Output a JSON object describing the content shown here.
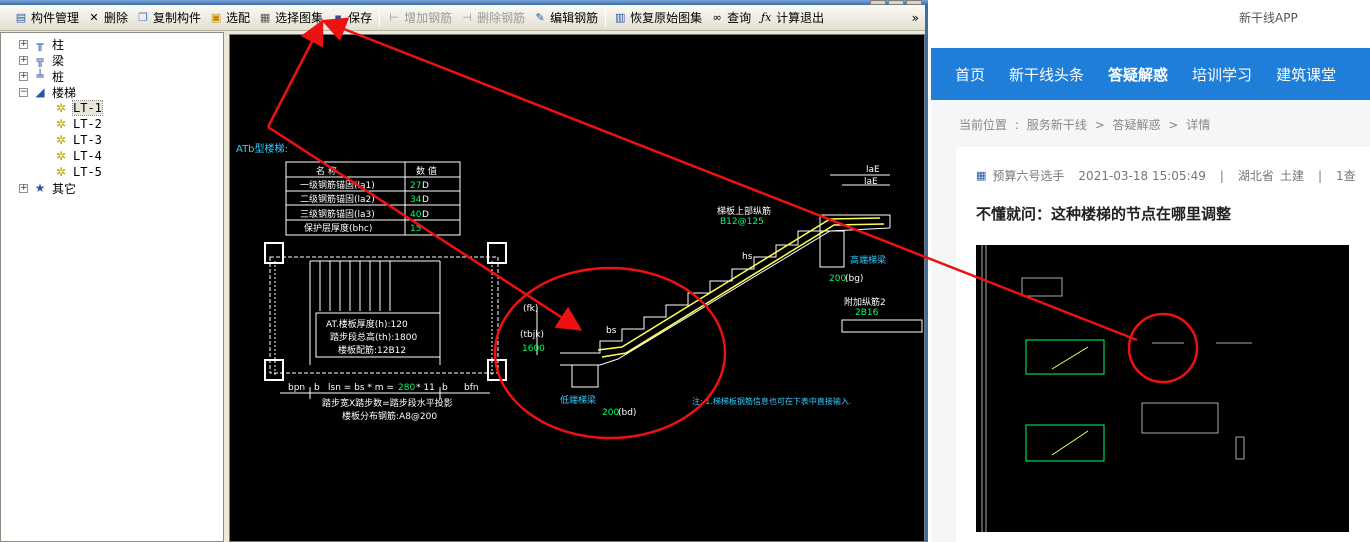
{
  "toolbar": {
    "items": [
      {
        "label": "构件管理",
        "icon": "list-icon",
        "enabled": true
      },
      {
        "label": "删除",
        "icon": "close-icon",
        "enabled": true
      },
      {
        "label": "复制构件",
        "icon": "copy-icon",
        "enabled": true
      },
      {
        "label": "选配",
        "icon": "select-icon",
        "enabled": true
      },
      {
        "label": "选择图集",
        "icon": "atlas-icon",
        "enabled": true
      },
      {
        "label": "保存",
        "icon": "save-icon",
        "enabled": true
      },
      {
        "label": "增加钢筋",
        "icon": "add-rebar-icon",
        "enabled": false
      },
      {
        "label": "删除钢筋",
        "icon": "delete-rebar-icon",
        "enabled": false
      },
      {
        "label": "编辑钢筋",
        "icon": "edit-rebar-icon",
        "enabled": true
      },
      {
        "label": "恢复原始图集",
        "icon": "restore-icon",
        "enabled": true
      },
      {
        "label": "查询",
        "icon": "binoculars-icon",
        "enabled": true
      },
      {
        "label": "计算退出",
        "icon": "fx-icon",
        "enabled": true
      }
    ],
    "overflow": "»"
  },
  "tree": {
    "items": [
      {
        "label": "柱",
        "expander": "+"
      },
      {
        "label": "梁",
        "expander": "+"
      },
      {
        "label": "桩",
        "expander": "+"
      },
      {
        "label": "楼梯",
        "expander": "−"
      },
      {
        "label": "LT-1"
      },
      {
        "label": "LT-2"
      },
      {
        "label": "LT-3"
      },
      {
        "label": "LT-4"
      },
      {
        "label": "LT-5"
      },
      {
        "label": "其它",
        "expander": "+"
      }
    ]
  },
  "drawing": {
    "title": "ATb型楼梯:",
    "table_headers": [
      "名  称",
      "数  值"
    ],
    "table_rows": [
      {
        "name": "一级钢筋锚固(la1)",
        "value": "27",
        "unit": "D"
      },
      {
        "name": "二级钢筋锚固(la2)",
        "value": "34",
        "unit": "D"
      },
      {
        "name": "三级钢筋锚固(la3)",
        "value": "40",
        "unit": "D"
      },
      {
        "name": "保护层厚度(bhc)",
        "value": "15",
        "unit": ""
      }
    ],
    "plan_notes": [
      "AT.楼板厚度(h):120",
      "踏步段总高(th):1800",
      "楼板配筋:12B12"
    ],
    "plan_dims": [
      "bpn",
      "b",
      "lsn = bs * m =",
      "280",
      "* 11",
      "b",
      "bfn"
    ],
    "plan_captions": [
      "踏步宽X踏步数=踏步段水平投影",
      "楼板分布钢筋:A8@200"
    ],
    "elev_labels": {
      "upper_rebar": "梯板上部纵筋",
      "upper_rebar_val": "B12@125",
      "high_beam": "高端梯梁",
      "low_beam": "低端梯梁",
      "extra_rebar": "附加纵筋2",
      "extra_rebar_val": "2B16",
      "bs": "bs",
      "hs": "hs",
      "fk": "(fk)",
      "tbjk": "(tbjk)",
      "tbjk_val": "1600",
      "bd": "(bd)",
      "bd_val": "200",
      "bg": "(bg)",
      "bg_val": "200",
      "la": "laE",
      "la2": "laE",
      "note": "注: 1.梯梯板钢筋信息也可在下表中直接输入."
    }
  },
  "web": {
    "app_label": "新干线APP",
    "nav": [
      {
        "label": "首页",
        "active": false
      },
      {
        "label": "新干线头条",
        "active": false
      },
      {
        "label": "答疑解惑",
        "active": true
      },
      {
        "label": "培训学习",
        "active": false
      },
      {
        "label": "建筑课堂",
        "active": false
      }
    ],
    "breadcrumb": [
      "当前位置",
      ":",
      "服务新干线",
      ">",
      "答疑解惑",
      ">",
      "详情"
    ],
    "post": {
      "author": "预算六号选手",
      "datetime": "2021-03-18 15:05:49",
      "sep1": "|",
      "region": "湖北省",
      "category": "土建",
      "sep2": "|",
      "views": "1查",
      "title": "不懂就问：这种楼梯的节点在哪里调整"
    }
  },
  "colors": {
    "accent_blue": "#1f7fd8",
    "annotation_red": "#ee1111",
    "cad_yellow": "#ffff55",
    "cad_green": "#00ff66",
    "cad_cyan": "#33ccff"
  }
}
